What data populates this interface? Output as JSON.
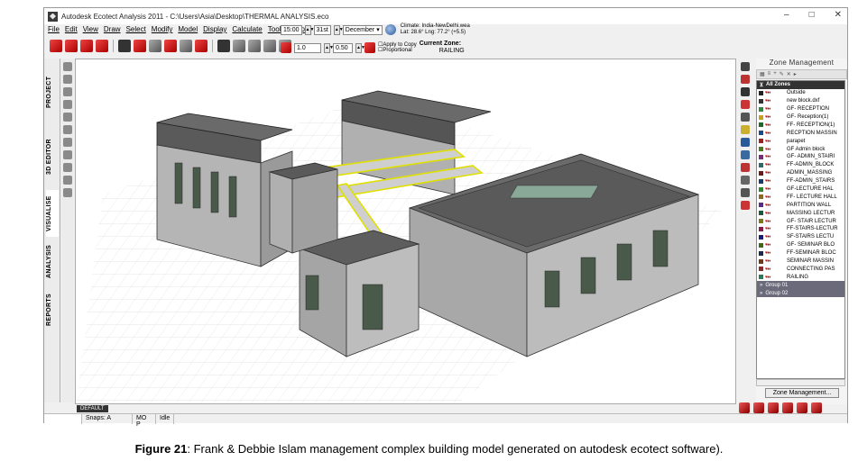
{
  "window": {
    "title": "Autodesk Ecotect Analysis 2011 - C:\\Users\\Asia\\Desktop\\THERMAL ANALYSIS.eco",
    "minimize": "–",
    "maximize": "□",
    "close": "✕"
  },
  "menu": [
    "File",
    "Edit",
    "View",
    "Draw",
    "Select",
    "Modify",
    "Model",
    "Display",
    "Calculate",
    "Tools",
    "Help"
  ],
  "controls": {
    "time": "15:00",
    "day": "31st",
    "month": "December",
    "climate_line1": "Climate: India-NewDelhi.wea",
    "climate_line2": "Lat: 28.6°   Lng: 77.2° (+5.5)",
    "value1": "1.0",
    "value2": "0.50",
    "apply_to_copy": "Apply to Copy",
    "proportional": "Proportional",
    "current_zone_label": "Current Zone:",
    "current_zone_value": "RAILING"
  },
  "left_tabs": [
    "PROJECT",
    "3D EDITOR",
    "VISUALISE",
    "ANALYSIS",
    "REPORTS"
  ],
  "viewport_tab": "DEFAULT",
  "status": {
    "snaps": "Snaps: A",
    "mode": "MO P",
    "state": "Idle"
  },
  "zone_panel": {
    "title": "Zone Management",
    "all_zones": "All Zones",
    "zones": [
      {
        "name": "Outside",
        "color": "#222222"
      },
      {
        "name": "new block.dxf",
        "color": "#333333"
      },
      {
        "name": "GF- RECEPTION",
        "color": "#2e8b3a"
      },
      {
        "name": "GF- Reception(1)",
        "color": "#c8a020"
      },
      {
        "name": "FF- RECEPTION(1)",
        "color": "#1a6a2a"
      },
      {
        "name": "RECPTION MASSIN",
        "color": "#1a4a8a"
      },
      {
        "name": "parapet",
        "color": "#a02020"
      },
      {
        "name": "GF Admin block",
        "color": "#4a7a1a"
      },
      {
        "name": "GF- ADMIN_STAIRI",
        "color": "#7a2a7a"
      },
      {
        "name": "FF-ADMIN_BLOCK",
        "color": "#2a6a6a"
      },
      {
        "name": "ADMIN_MASSING",
        "color": "#6a1a1a"
      },
      {
        "name": "FF-ADMIN_STAIRS",
        "color": "#1a3a6a"
      },
      {
        "name": "GF-LECTURE HAL",
        "color": "#2a8a2a"
      },
      {
        "name": "FF- LECTURE HALL",
        "color": "#8a6a1a"
      },
      {
        "name": "PARTITION WALL",
        "color": "#5a2a8a"
      },
      {
        "name": "MASSING LECTUR",
        "color": "#1a5a3a"
      },
      {
        "name": "GF- STAIR LECTUR",
        "color": "#7a7a1a"
      },
      {
        "name": "FF-STAIRS-LECTUR",
        "color": "#8a1a4a"
      },
      {
        "name": "SF-STAIRS LECTU",
        "color": "#1a1a7a"
      },
      {
        "name": "GF- SEMINAR BLO",
        "color": "#3a6a1a"
      },
      {
        "name": "FF-SEMINAR BLOC",
        "color": "#1a2a4a"
      },
      {
        "name": "SEMINAR MASSIN",
        "color": "#6a3a1a"
      },
      {
        "name": "CONNECTING PAS",
        "color": "#8a2a2a"
      },
      {
        "name": "RAILING",
        "color": "#2a7a5a"
      }
    ],
    "groups": [
      "Group 01",
      "Group 02"
    ],
    "manage_button": "Zone Management..."
  },
  "caption": {
    "label": "Figure 21",
    "text": ": Frank & Debbie Islam management complex building model generated on autodesk ecotect software)."
  }
}
